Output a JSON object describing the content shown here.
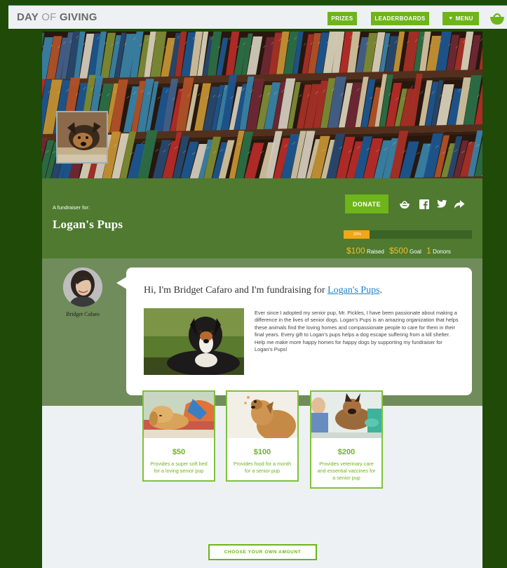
{
  "brand": {
    "word1": "DAY",
    "word2": " OF ",
    "word3": "GIVING"
  },
  "nav": {
    "prizes": "PRIZES",
    "leaderboards": "LEADERBOARDS",
    "menu": "MENU"
  },
  "fundraiser": {
    "label": "A fundraiser for:",
    "org": "Logan's Pups",
    "donate": "DONATE",
    "progress_percent": 20,
    "progress_label": "20%",
    "raised": "$100",
    "raised_label": "Raised",
    "goal": "$500",
    "goal_label": "Goal",
    "donors": "1",
    "donors_label": "Donors"
  },
  "story": {
    "author": "Bridget Cafaro",
    "headline_prefix": "Hi, I'm Bridget Cafaro",
    "headline_mid": " and I'm fundraising for ",
    "headline_link": "Logan's Pups",
    "headline_end": ".",
    "body": "Ever since I adopted my senior pup, Mr. Pickles, I have been passionate about making a difference in the lives of senior dogs. Logan's Pups is an amazing organization that helps these animals find the loving homes and compassionate people to care for them in their final years. Every gift to Logan's pups helps a dog escape suffering from a kill shelter. Help me make more happy homes for happy dogs by supporting my fundraiser for Logan's Pups!"
  },
  "tiers": [
    {
      "amount": "$50",
      "desc": "Provides a super soft bed for a loving senior pup"
    },
    {
      "amount": "$100",
      "desc": "Provides food for a month for a senior pup"
    },
    {
      "amount": "$200",
      "desc": "Provides veterinary care and essential vaccines for a senior pup"
    }
  ],
  "choose_own": "CHOOSE YOUR OWN AMOUNT",
  "colors": {
    "accent_green": "#6eb41b",
    "band_green": "#4f7a30",
    "story_band": "#6f8c5a",
    "page_bg": "#eef1f3",
    "progress_fill": "#f2a618",
    "stat_number": "#f2bd28",
    "link_blue": "#1f7fc7",
    "outer_bg": "#1f4a08"
  },
  "icons": [
    "basket-icon",
    "facebook-icon",
    "twitter-icon",
    "share-arrow-icon",
    "caret-down-icon"
  ]
}
